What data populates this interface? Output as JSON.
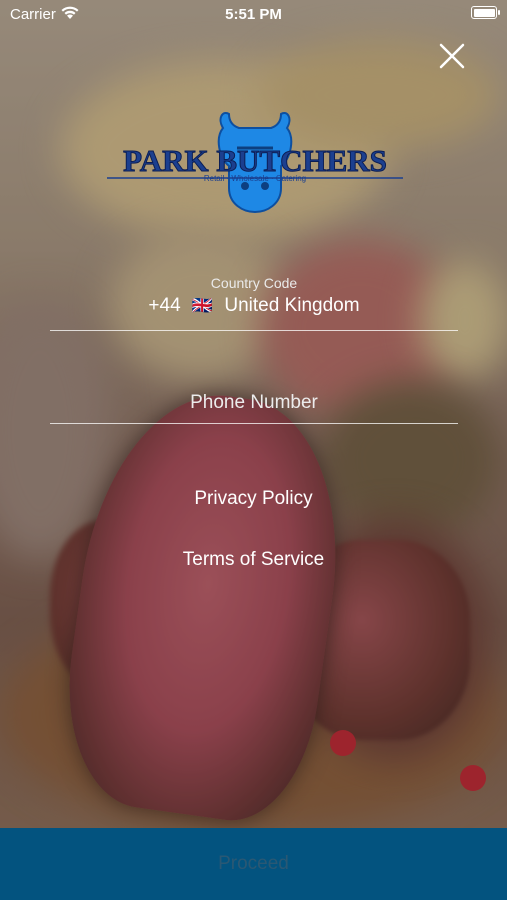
{
  "status_bar": {
    "carrier": "Carrier",
    "time": "5:51 PM"
  },
  "logo": {
    "name": "PARK BUTCHERS",
    "tagline": "Retail · Wholesale · Catering",
    "brand_color": "#1e6fd0"
  },
  "country": {
    "label": "Country Code",
    "dial_code": "+44",
    "flag": "🇬🇧",
    "name": "United Kingdom"
  },
  "phone": {
    "placeholder": "Phone Number",
    "value": ""
  },
  "links": {
    "privacy": "Privacy Policy",
    "terms": "Terms of Service"
  },
  "footer": {
    "proceed_label": "Proceed",
    "color": "#03537f"
  }
}
